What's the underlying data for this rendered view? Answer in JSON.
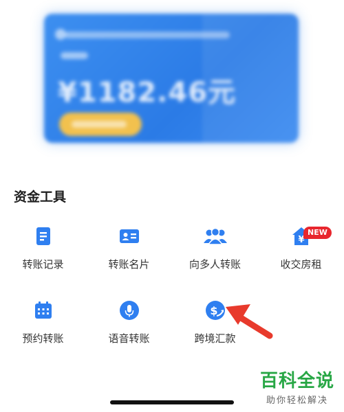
{
  "promo": {
    "amount": "¥1182.46元"
  },
  "section": {
    "title": "资金工具"
  },
  "tools": [
    {
      "label": "转账记录",
      "icon": "document-list-icon"
    },
    {
      "label": "转账名片",
      "icon": "id-card-icon"
    },
    {
      "label": "向多人转账",
      "icon": "multiple-users-icon"
    },
    {
      "label": "收交房租",
      "icon": "house-yuan-icon",
      "badge": "NEW"
    },
    {
      "label": "预约转账",
      "icon": "calendar-icon"
    },
    {
      "label": "语音转账",
      "icon": "microphone-icon"
    },
    {
      "label": "跨境汇款",
      "icon": "dollar-globe-icon"
    }
  ],
  "watermark": {
    "title": "百科全说",
    "subtitle": "助你轻松解决"
  },
  "colors": {
    "accent": "#2f7ff0",
    "badge": "#e8262d",
    "arrow": "#e83a2c",
    "watermark": "#28a745"
  }
}
